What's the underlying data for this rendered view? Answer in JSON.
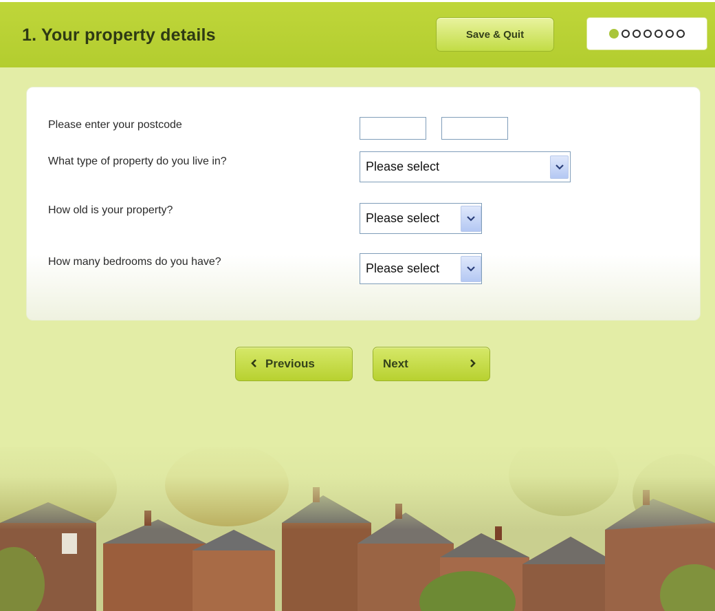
{
  "header": {
    "title": "1. Your property details",
    "save_label": "Save & Quit",
    "progress": {
      "total_steps": 7,
      "current_step": 1
    }
  },
  "form": {
    "postcode": {
      "label": "Please enter your postcode",
      "part1": "",
      "part2": ""
    },
    "property_type": {
      "label": "What type of property do you live in?",
      "value": "Please select"
    },
    "property_age": {
      "label": "How old is your property?",
      "value": "Please select"
    },
    "bedrooms": {
      "label": "How many bedrooms do you have?",
      "value": "Please select"
    }
  },
  "nav": {
    "previous_label": "Previous",
    "next_label": "Next"
  },
  "colors": {
    "header_green": "#b3cd2f",
    "page_background": "#e3eda6",
    "button_green": "#c3d83a",
    "active_dot": "#a9c53a"
  },
  "icons": {
    "previous": "chevron-left-icon",
    "next": "chevron-right-icon",
    "select": "chevron-down-icon"
  }
}
